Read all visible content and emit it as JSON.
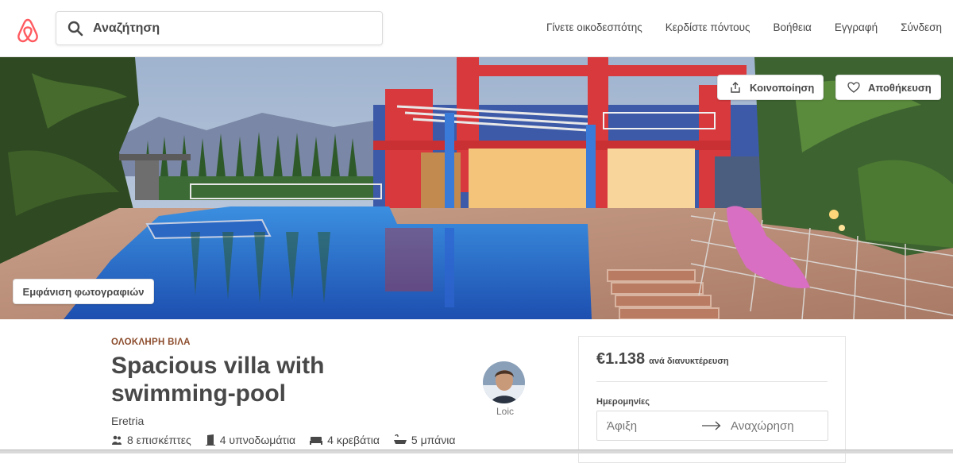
{
  "brand": {
    "color": "#FF5A5F",
    "logo_icon": "airbnb-belo-icon"
  },
  "search": {
    "placeholder": "Αναζήτηση",
    "icon": "search-icon"
  },
  "nav": {
    "become_host": "Γίνετε οικοδεσπότης",
    "earn_credit": "Κερδίστε πόντους",
    "help": "Βοήθεια",
    "signup": "Εγγραφή",
    "login": "Σύνδεση"
  },
  "hero": {
    "share_label": "Κοινοποίηση",
    "save_label": "Αποθήκευση",
    "view_photos_label": "Εμφάνιση φωτογραφιών"
  },
  "listing": {
    "type": "ΟΛΟΚΛΗΡΗ ΒΙΛΑ",
    "title": "Spacious villa with swimming-pool",
    "location": "Eretria",
    "host_name": "Loic",
    "amenities": {
      "guests": "8 επισκέπτες",
      "bedrooms": "4 υπνοδωμάτια",
      "beds": "4 κρεβάτια",
      "baths": "5 μπάνια"
    }
  },
  "booking": {
    "price": "€1.138",
    "per_night": "ανά διανυκτέρευση",
    "dates_label": "Ημερομηνίες",
    "checkin_placeholder": "Άφιξη",
    "checkout_placeholder": "Αναχώρηση"
  }
}
